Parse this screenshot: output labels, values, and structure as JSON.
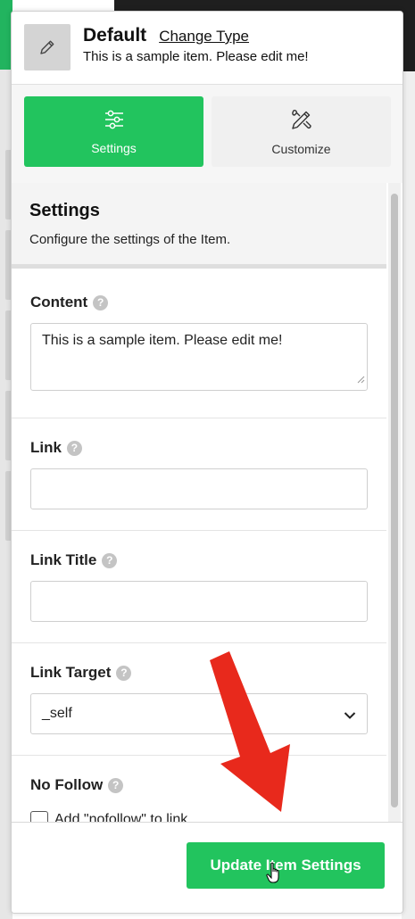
{
  "header": {
    "type_name": "Default",
    "change_type_label": "Change Type",
    "item_description": "This is a sample item. Please edit me!",
    "item_icon": "pencil-icon"
  },
  "tabs": [
    {
      "label": "Settings",
      "icon": "sliders-icon",
      "active": true
    },
    {
      "label": "Customize",
      "icon": "brush-pencil-icon",
      "active": false
    }
  ],
  "settings_section": {
    "title": "Settings",
    "description": "Configure the settings of the Item."
  },
  "fields": {
    "content": {
      "label": "Content",
      "value": "This is a sample item. Please edit me!"
    },
    "link": {
      "label": "Link",
      "value": ""
    },
    "link_title": {
      "label": "Link Title",
      "value": ""
    },
    "link_target": {
      "label": "Link Target",
      "value": "_self"
    },
    "no_follow": {
      "label": "No Follow",
      "checkbox_label": "Add \"nofollow\" to link",
      "checked": false
    }
  },
  "footer": {
    "update_button_label": "Update Item Settings"
  },
  "colors": {
    "accent_green": "#22c45e",
    "annotation_arrow": "#e8291c"
  }
}
